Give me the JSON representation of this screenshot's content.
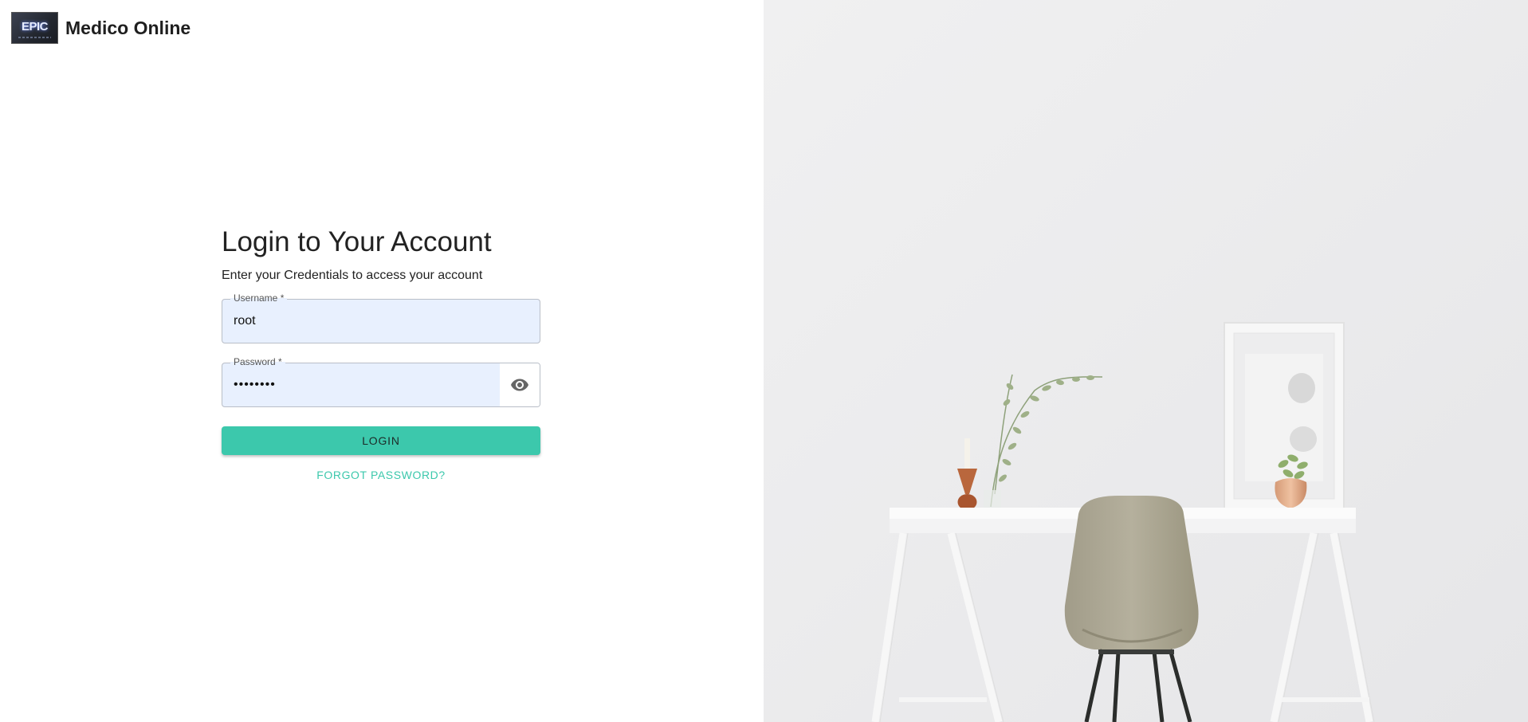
{
  "brand": {
    "logo_text": "EPIC",
    "app_name": "Medico Online"
  },
  "login": {
    "title": "Login to Your Account",
    "subtitle": "Enter your Credentials to access your account",
    "username_label": "Username *",
    "username_value": "root",
    "password_label": "Password *",
    "password_value": "••••••••",
    "login_button": "LOGIN",
    "forgot_link": "FORGOT PASSWORD?"
  },
  "icons": {
    "password_toggle": "eye-icon"
  },
  "colors": {
    "accent": "#3cc8ac",
    "input_fill": "#e8f0fe",
    "illustration_wall": "#ececed"
  }
}
